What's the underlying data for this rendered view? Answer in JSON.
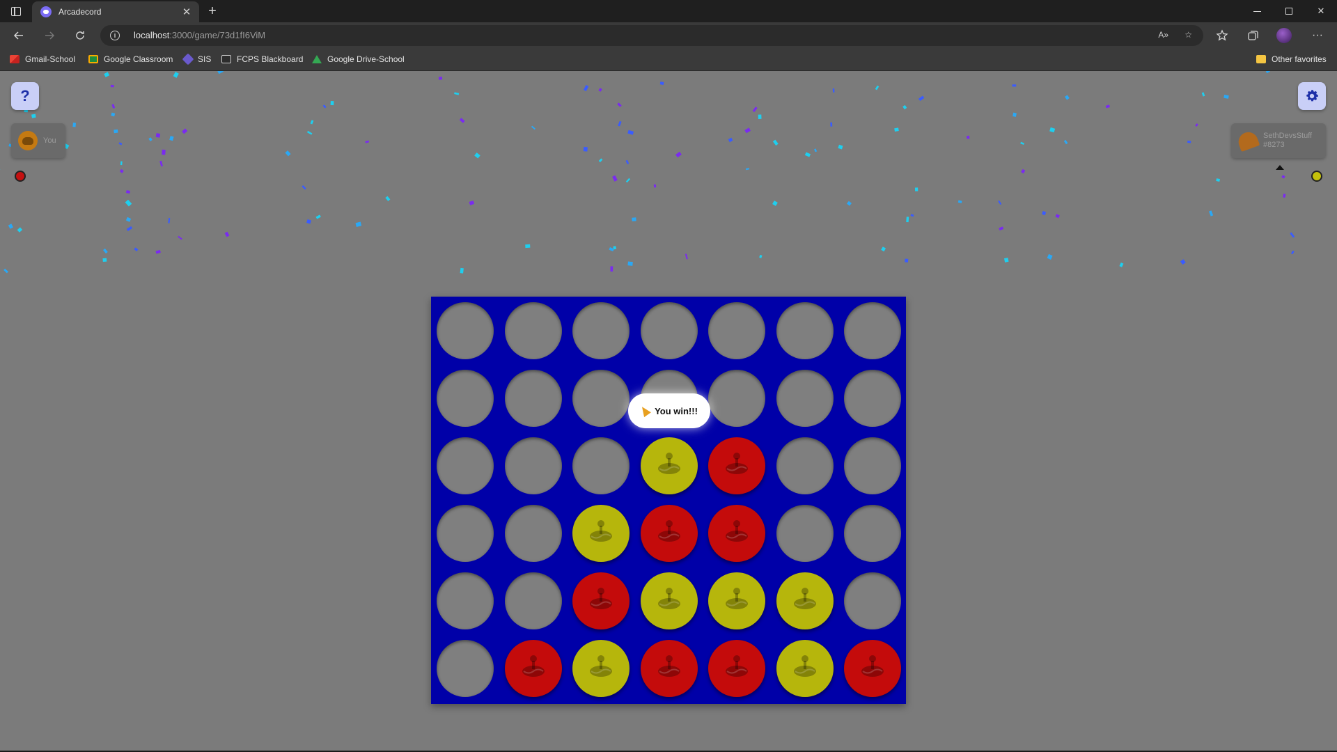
{
  "browser": {
    "tab_title": "Arcadecord",
    "url_host": "localhost",
    "url_rest": ":3000/game/73d1fI6ViM",
    "bookmarks": [
      {
        "label": "Gmail-School",
        "icon": "gmail-icon"
      },
      {
        "label": "Google Classroom",
        "icon": "google-classroom-icon"
      },
      {
        "label": "SIS",
        "icon": "sis-icon"
      },
      {
        "label": "FCPS Blackboard",
        "icon": "blackboard-icon"
      },
      {
        "label": "Google Drive-School",
        "icon": "google-drive-icon"
      }
    ],
    "other_favorites": "Other favorites"
  },
  "game": {
    "help_label": "?",
    "players": [
      {
        "name": "You",
        "color": "#c41010",
        "avatar": "discord-avatar-icon"
      },
      {
        "name_line1": "SethDevsStuff",
        "name_line2": "#8273",
        "color": "#c4c10c",
        "avatar": "taco-avatar-icon"
      }
    ],
    "win_message": "You win!!!",
    "board": {
      "columns": 7,
      "rows": 6,
      "cells": [
        [
          "",
          "",
          "",
          "",
          "",
          "",
          ""
        ],
        [
          "",
          "",
          "",
          "",
          "",
          "",
          ""
        ],
        [
          "",
          "",
          "",
          "Y",
          "R",
          "",
          ""
        ],
        [
          "",
          "",
          "Y",
          "R",
          "R",
          "",
          ""
        ],
        [
          "",
          "",
          "R",
          "Y",
          "Y",
          "Y",
          ""
        ],
        [
          "",
          "R",
          "Y",
          "R",
          "R",
          "Y",
          "R"
        ]
      ]
    },
    "colors": {
      "board": "#0000a8",
      "red": "#c40b0b",
      "yellow": "#b6b60c",
      "empty": "#7f7f7f",
      "background": "#7b7b7b"
    }
  }
}
